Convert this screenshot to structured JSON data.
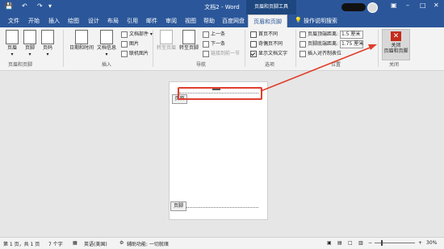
{
  "titlebar": {
    "title": "文档2 - Word",
    "context_tool": "页眉和页脚工具",
    "quick_access": {
      "save": "💾",
      "undo": "↶",
      "redo": "↷",
      "customize": "▾"
    },
    "window_controls": {
      "ribbon_display": "▣",
      "minimize": "–",
      "maximize": "□",
      "close": "✕"
    }
  },
  "tabs": [
    "文件",
    "开始",
    "插入",
    "绘图",
    "设计",
    "布局",
    "引用",
    "邮件",
    "审阅",
    "视图",
    "帮助",
    "百度网盘"
  ],
  "active_tab": "页眉和页脚",
  "tell_me": "操作说明搜索",
  "ribbon": {
    "groups": {
      "header_footer": {
        "label": "页眉和页脚",
        "buttons": [
          {
            "label": "页眉",
            "icon": "header-icon"
          },
          {
            "label": "页脚",
            "icon": "footer-icon"
          },
          {
            "label": "页码",
            "icon": "page-number-icon"
          }
        ]
      },
      "insert": {
        "label": "插入",
        "date_time": "日期和时间",
        "doc_info": "文档信息",
        "doc_parts": "文档部件",
        "picture": "图片",
        "online_picture": "联机图片"
      },
      "navigation": {
        "label": "导航",
        "goto_header": "转至页眉",
        "goto_footer": "转至页脚",
        "previous": "上一条",
        "next": "下一条",
        "link_previous": "链接到前一节"
      },
      "options": {
        "label": "选项",
        "first_page_diff": "首页不同",
        "odd_even_diff": "奇偶页不同",
        "show_doc_text": "显示文档文字",
        "show_doc_text_checked": true
      },
      "position": {
        "label": "位置",
        "header_top": "页眉顶端距离:",
        "header_top_value": "1.5 厘米",
        "footer_bottom": "页脚底端距离:",
        "footer_bottom_value": "1.75 厘米",
        "align_tab": "插入对齐制表位"
      },
      "close": {
        "label": "关闭",
        "button_line1": "关闭",
        "button_line2": "页眉和页脚"
      }
    }
  },
  "document": {
    "header_tag": "页眉",
    "footer_tag": "页脚"
  },
  "statusbar": {
    "page": "第 1 页，共 1 页",
    "words": "7 个字",
    "language": "英语(美国)",
    "accessibility": "辅助功能: 一切就绪",
    "zoom": "30%",
    "zoom_minus": "−",
    "zoom_plus": "+"
  },
  "colors": {
    "accent": "#2b579a",
    "callout": "#e03e2d",
    "close_red": "#c42b1c"
  }
}
